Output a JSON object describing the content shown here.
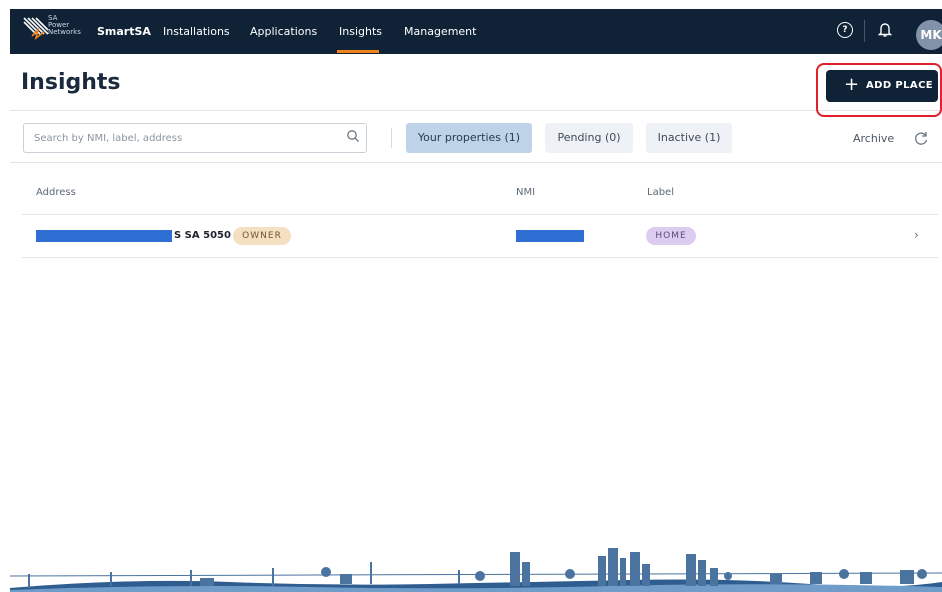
{
  "nav": {
    "logo_text": [
      "SA",
      "Power",
      "Networks"
    ],
    "brand": "SmartSA",
    "items": [
      "Installations",
      "Applications",
      "Insights",
      "Management"
    ],
    "active": "Insights",
    "avatar_initials": "MK"
  },
  "page": {
    "title": "Insights",
    "add_button_label": "ADD PLACE"
  },
  "filters": {
    "search_placeholder": "Search by NMI, label, address",
    "tabs": [
      "Your properties (1)",
      "Pending (0)",
      "Inactive (1)"
    ],
    "active_tab": "Your properties (1)",
    "archive_label": "Archive"
  },
  "table": {
    "headers": [
      "Address",
      "NMI",
      "Label"
    ],
    "rows": [
      {
        "address_suffix": "S SA 5050",
        "role_badge": "OWNER",
        "label_badge": "HOME"
      }
    ]
  },
  "colors": {
    "topbar": "#0f2236",
    "nav_accent": "#f0821e",
    "active_tab": "#bed3e8",
    "owner_badge": "#f5dfc1",
    "home_badge": "#dccdf0",
    "redaction": "#2e6fd4",
    "highlight": "#e0202a"
  },
  "icons": [
    "logo-icon",
    "help-icon",
    "bell-icon",
    "search-icon",
    "refresh-icon",
    "chevron-right-icon",
    "plus-icon"
  ]
}
